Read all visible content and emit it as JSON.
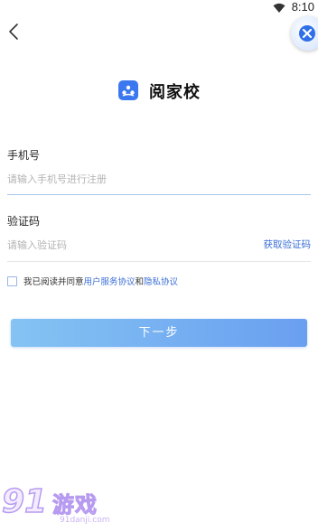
{
  "status_bar": {
    "time": "8:10",
    "wifi_icon": "wifi-icon"
  },
  "header": {
    "back_icon": "back-arrow-icon",
    "float_icon": "floating-assistant-icon"
  },
  "app": {
    "name": "阅家校",
    "logo_icon": "app-logo-icon",
    "brand_color": "#3b78f0"
  },
  "form": {
    "phone_label": "手机号",
    "phone_placeholder": "请输入手机号进行注册",
    "phone_value": "",
    "code_label": "验证码",
    "code_placeholder": "请输入验证码",
    "code_value": "",
    "get_code_label": "获取验证码"
  },
  "agreement": {
    "checked": false,
    "prefix": "我已阅读并同意",
    "service_link": "用户服务协议",
    "and": "和",
    "privacy_link": "隐私协议"
  },
  "next_button": {
    "label": "下一步"
  },
  "watermark": {
    "num": "91",
    "cn": "游戏",
    "url": "91danji.com"
  },
  "colors": {
    "link": "#3b6fd6",
    "button_start": "#84c3f3",
    "button_end": "#6a9ff0"
  }
}
